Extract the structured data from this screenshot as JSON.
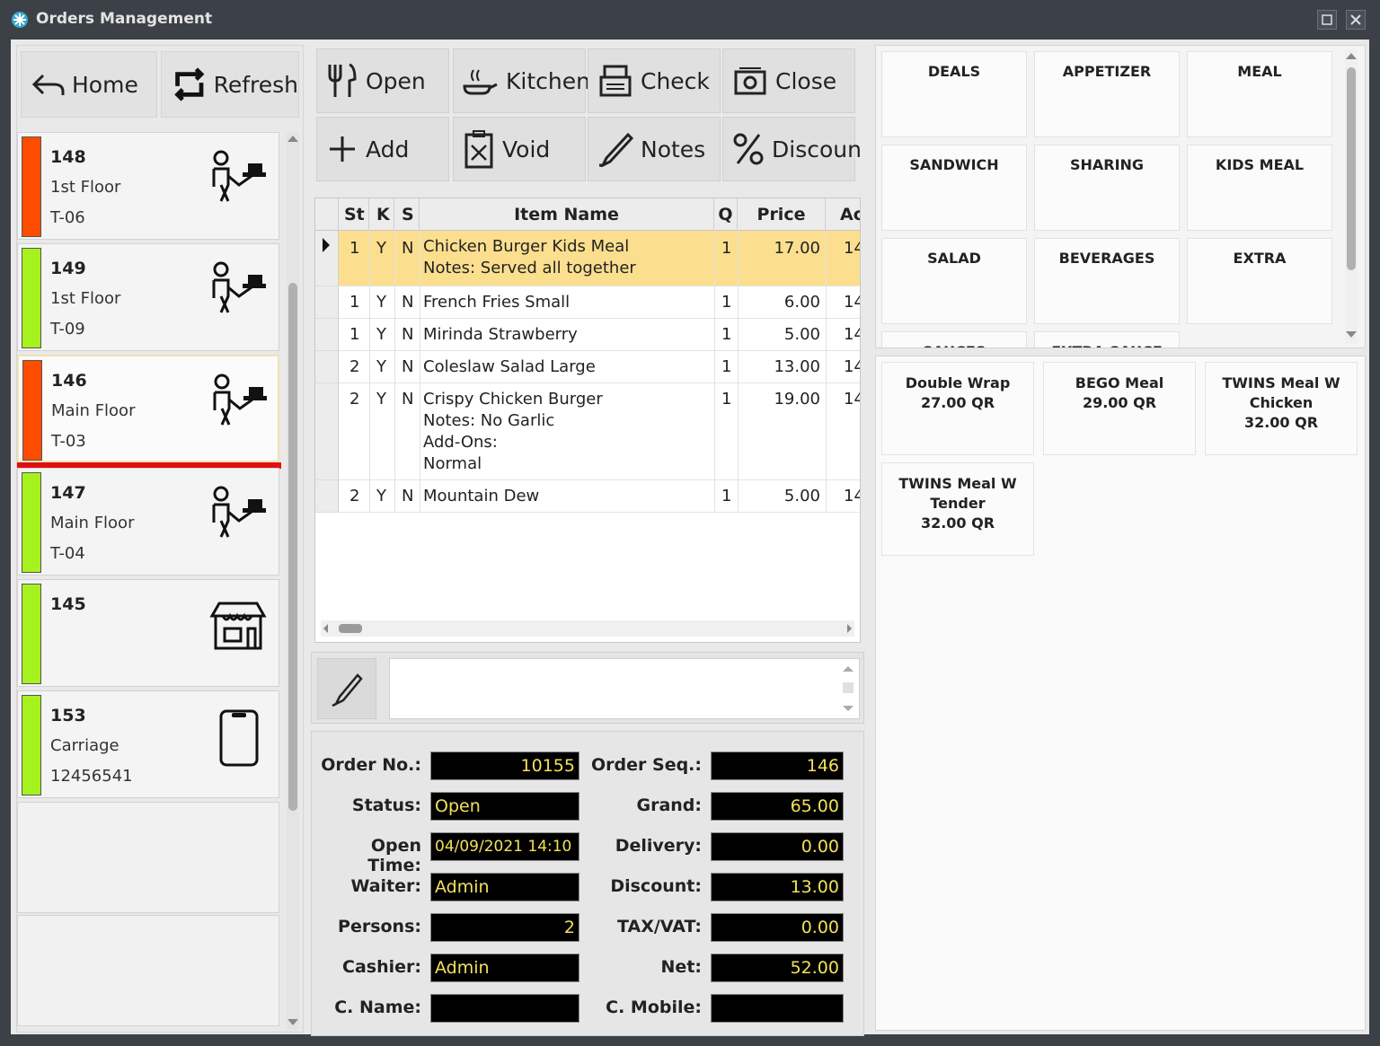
{
  "window": {
    "title": "Orders Management"
  },
  "nav": {
    "home": "Home",
    "refresh": "Refresh"
  },
  "orders": [
    {
      "num": "148",
      "floor": "1st Floor",
      "table": "T-06",
      "color": "#ff4d00",
      "icon": "waiter-icon"
    },
    {
      "num": "149",
      "floor": "1st Floor",
      "table": "T-09",
      "color": "#a6f21e",
      "icon": "waiter-icon"
    },
    {
      "num": "146",
      "floor": "Main Floor",
      "table": "T-03",
      "color": "#ff4d00",
      "icon": "waiter-icon"
    },
    {
      "num": "147",
      "floor": "Main Floor",
      "table": "T-04",
      "color": "#a6f21e",
      "icon": "waiter-icon"
    },
    {
      "num": "145",
      "floor": "",
      "table": "",
      "color": "#a6f21e",
      "icon": "takeaway-shop-icon"
    },
    {
      "num": "153",
      "floor": "Carriage",
      "table": "12456541",
      "color": "#a6f21e",
      "icon": "mobile-phone-icon"
    }
  ],
  "actions": {
    "open": "Open",
    "kitchen": "Kitchen",
    "check": "Check",
    "close": "Close",
    "add": "Add",
    "void": "Void",
    "notes": "Notes",
    "discount": "Discoun"
  },
  "grid": {
    "headers": {
      "st": "St",
      "k": "K",
      "s": "S",
      "item": "Item Name",
      "q": "Q",
      "price": "Price",
      "ac": "Ac"
    },
    "rows": [
      {
        "st": "1",
        "k": "Y",
        "s": "N",
        "item": "Chicken Burger Kids Meal",
        "notes": [
          "Notes: Served all together"
        ],
        "q": "1",
        "price": "17.00",
        "ac": "14"
      },
      {
        "st": "1",
        "k": "Y",
        "s": "N",
        "item": "French Fries Small",
        "notes": [],
        "q": "1",
        "price": "6.00",
        "ac": "14"
      },
      {
        "st": "1",
        "k": "Y",
        "s": "N",
        "item": "Mirinda Strawberry",
        "notes": [],
        "q": "1",
        "price": "5.00",
        "ac": "14"
      },
      {
        "st": "2",
        "k": "Y",
        "s": "N",
        "item": "Coleslaw Salad Large",
        "notes": [],
        "q": "1",
        "price": "13.00",
        "ac": "14"
      },
      {
        "st": "2",
        "k": "Y",
        "s": "N",
        "item": "Crispy Chicken Burger",
        "notes": [
          "Notes: No Garlic",
          "Add-Ons:",
          "Normal"
        ],
        "q": "1",
        "price": "19.00",
        "ac": "14"
      },
      {
        "st": "2",
        "k": "Y",
        "s": "N",
        "item": "Mountain Dew",
        "notes": [],
        "q": "1",
        "price": "5.00",
        "ac": "14"
      }
    ]
  },
  "info": {
    "order_no_label": "Order No.:",
    "order_no": "10155",
    "order_seq_label": "Order Seq.:",
    "order_seq": "146",
    "status_label": "Status:",
    "status": "Open",
    "grand_label": "Grand:",
    "grand": "65.00",
    "open_time_label": "Open Time:",
    "open_time": "04/09/2021 14:10",
    "delivery_label": "Delivery:",
    "delivery": "0.00",
    "waiter_label": "Waiter:",
    "waiter": "Admin",
    "discount_label": "Discount:",
    "discount": "13.00",
    "persons_label": "Persons:",
    "persons": "2",
    "tax_label": "TAX/VAT:",
    "tax": "0.00",
    "cashier_label": "Cashier:",
    "cashier": "Admin",
    "net_label": "Net:",
    "net": "52.00",
    "cname_label": "C. Name:",
    "cname": "",
    "cmobile_label": "C. Mobile:",
    "cmobile": ""
  },
  "categories": [
    "DEALS",
    "APPETIZER",
    "MEAL",
    "SANDWICH",
    "SHARING",
    "KIDS MEAL",
    "SALAD",
    "BEVERAGES",
    "EXTRA",
    "SAUCES",
    "EXTRA SAUCE FREE"
  ],
  "menu_items": [
    {
      "name": "Double Wrap",
      "price": "27.00 QR"
    },
    {
      "name": "BEGO Meal",
      "price": "29.00 QR"
    },
    {
      "name": "TWINS Meal W Chicken",
      "price": "32.00 QR"
    },
    {
      "name": "TWINS Meal W Tender",
      "price": "32.00 QR"
    }
  ],
  "colors": {
    "status_red": "#ff4d00",
    "status_green": "#a6f21e",
    "highlight_row": "#fbdf8e",
    "field_text": "#f2e15a"
  }
}
